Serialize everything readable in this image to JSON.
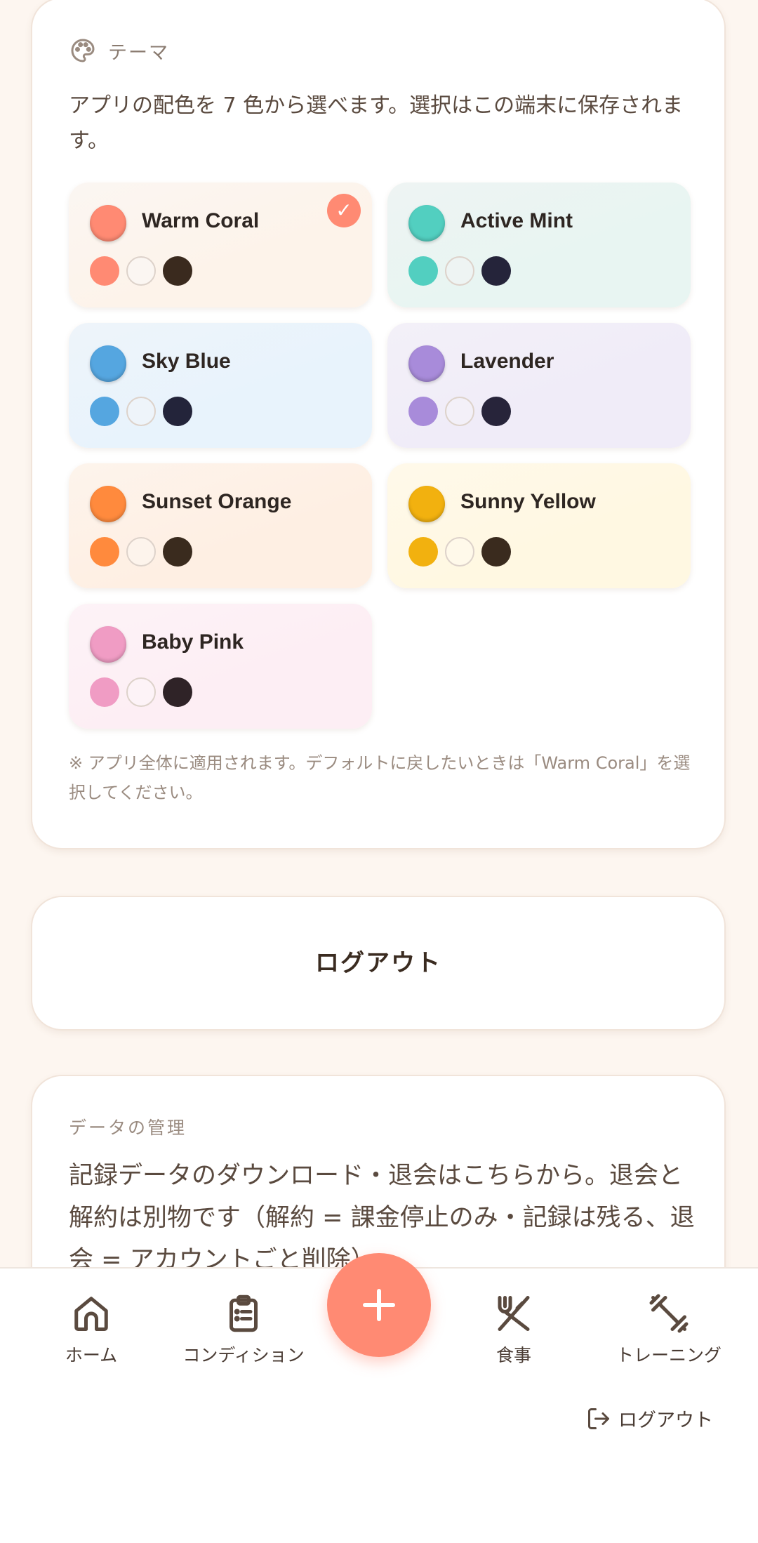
{
  "theme": {
    "header": "テーマ",
    "description": "アプリの配色を 7 色から選べます。選択はこの端末に保存されます。",
    "selected": "Warm Coral",
    "check_mark": "✓",
    "options": [
      {
        "name": "Warm Coral",
        "main": "#ff8a73",
        "bg": "#fdf3ea",
        "light": "#fbf6f2",
        "dark": "#3a2a1e"
      },
      {
        "name": "Active Mint",
        "main": "#52cfc0",
        "bg": "#e8f5f2",
        "light": "#eef4f3",
        "dark": "#25243a"
      },
      {
        "name": "Sky Blue",
        "main": "#55a6e0",
        "bg": "#e8f3fc",
        "light": "#eef4fa",
        "dark": "#23243a"
      },
      {
        "name": "Lavender",
        "main": "#a88bda",
        "bg": "#f0ecf8",
        "light": "#f3f0f8",
        "dark": "#27243a"
      },
      {
        "name": "Sunset Orange",
        "main": "#ff8a3d",
        "bg": "#feefe3",
        "light": "#fdf4ec",
        "dark": "#3a2b1e"
      },
      {
        "name": "Sunny Yellow",
        "main": "#f2b10f",
        "bg": "#fff8e2",
        "light": "#fff9ea",
        "dark": "#3a2b1e"
      },
      {
        "name": "Baby Pink",
        "main": "#f09cc4",
        "bg": "#fdeef4",
        "light": "#fdf3f7",
        "dark": "#2f2327"
      }
    ],
    "note": "※ アプリ全体に適用されます。デフォルトに戻したいときは「Warm Coral」を選択してください。"
  },
  "logout_card": {
    "label": "ログアウト"
  },
  "data_management": {
    "title": "データの管理",
    "description": "記録データのダウンロード・退会はこちらから。退会と解約は別物です（解約 = 課金停止のみ・記録は残る、退会 = アカウントごと削除）。"
  },
  "bottom_nav": {
    "items": [
      {
        "label": "ホーム",
        "icon": "home-icon"
      },
      {
        "label": "コンディション",
        "icon": "clipboard-icon"
      },
      {
        "label": "食事",
        "icon": "utensils-icon"
      },
      {
        "label": "トレーニング",
        "icon": "dumbbell-icon"
      }
    ],
    "fab_icon": "plus-icon"
  },
  "footer": {
    "logout_label": "ログアウト",
    "logout_icon": "logout-icon"
  },
  "colors": {
    "accent": "#ff8a73",
    "background": "#fdf6f0"
  }
}
